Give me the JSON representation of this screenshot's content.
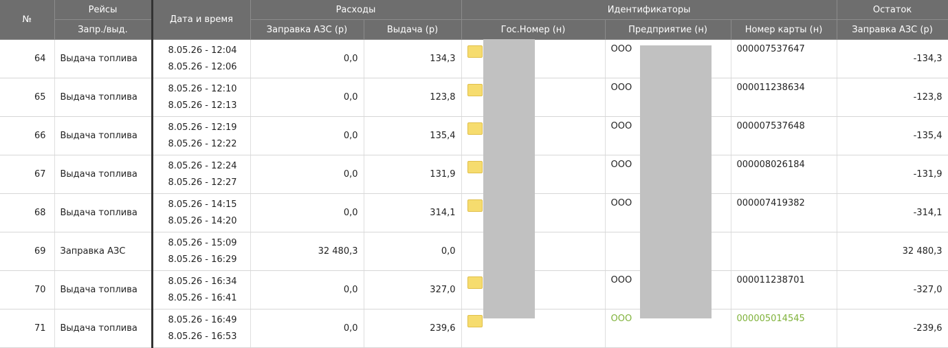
{
  "header": {
    "no": "№",
    "trips": "Рейсы",
    "trips_sub": "Запр./выд.",
    "datetime": "Дата и время",
    "expenses": "Расходы",
    "exp_refuel": "Заправка АЗС (р)",
    "exp_issue": "Выдача (р)",
    "identifiers": "Идентификаторы",
    "id_plate": "Гос.Номер (н)",
    "id_company": "Предприятие (н)",
    "id_card": "Номер карты (н)",
    "balance": "Остаток",
    "bal_refuel": "Заправка АЗС (р)"
  },
  "rows": [
    {
      "no": "64",
      "type": "Выдача топлива",
      "start": "8.05.26 - 12:04",
      "end": "8.05.26 - 12:06",
      "refuel": "0,0",
      "issue": "134,3",
      "company": "ООО",
      "card": "000007537647",
      "balance": "-134,3"
    },
    {
      "no": "65",
      "type": "Выдача топлива",
      "start": "8.05.26 - 12:10",
      "end": "8.05.26 - 12:13",
      "refuel": "0,0",
      "issue": "123,8",
      "company": "ООО",
      "card": "000011238634",
      "balance": "-123,8"
    },
    {
      "no": "66",
      "type": "Выдача топлива",
      "start": "8.05.26 - 12:19",
      "end": "8.05.26 - 12:22",
      "refuel": "0,0",
      "issue": "135,4",
      "company": "ООО",
      "card": "000007537648",
      "balance": "-135,4"
    },
    {
      "no": "67",
      "type": "Выдача топлива",
      "start": "8.05.26 - 12:24",
      "end": "8.05.26 - 12:27",
      "refuel": "0,0",
      "issue": "131,9",
      "company": "ООО",
      "card": "000008026184",
      "balance": "-131,9"
    },
    {
      "no": "68",
      "type": "Выдача топлива",
      "start": "8.05.26 - 14:15",
      "end": "8.05.26 - 14:20",
      "refuel": "0,0",
      "issue": "314,1",
      "company": "ООО",
      "card": "000007419382",
      "balance": "-314,1"
    },
    {
      "no": "69",
      "type": "Заправка АЗС",
      "start": "8.05.26 - 15:09",
      "end": "8.05.26 - 16:29",
      "refuel": "32 480,3",
      "issue": "0,0",
      "company": "",
      "card": "",
      "balance": "32 480,3"
    },
    {
      "no": "70",
      "type": "Выдача топлива",
      "start": "8.05.26 - 16:34",
      "end": "8.05.26 - 16:41",
      "refuel": "0,0",
      "issue": "327,0",
      "company": "ООО",
      "card": "000011238701",
      "balance": "-327,0"
    },
    {
      "no": "71",
      "type": "Выдача топлива",
      "start": "8.05.26 - 16:49",
      "end": "8.05.26 - 16:53",
      "refuel": "0,0",
      "issue": "239,6",
      "company": "ООО",
      "card": "000005014545",
      "balance": "-239,6"
    }
  ],
  "colors": {
    "header_bg": "#6e6e6e",
    "header_text": "#ffffff",
    "highlight_text": "#7fb23a",
    "folder": "#f6dc6e",
    "redaction": "#c1c1c1"
  },
  "icons": {
    "plate_icon": "folder-icon"
  }
}
